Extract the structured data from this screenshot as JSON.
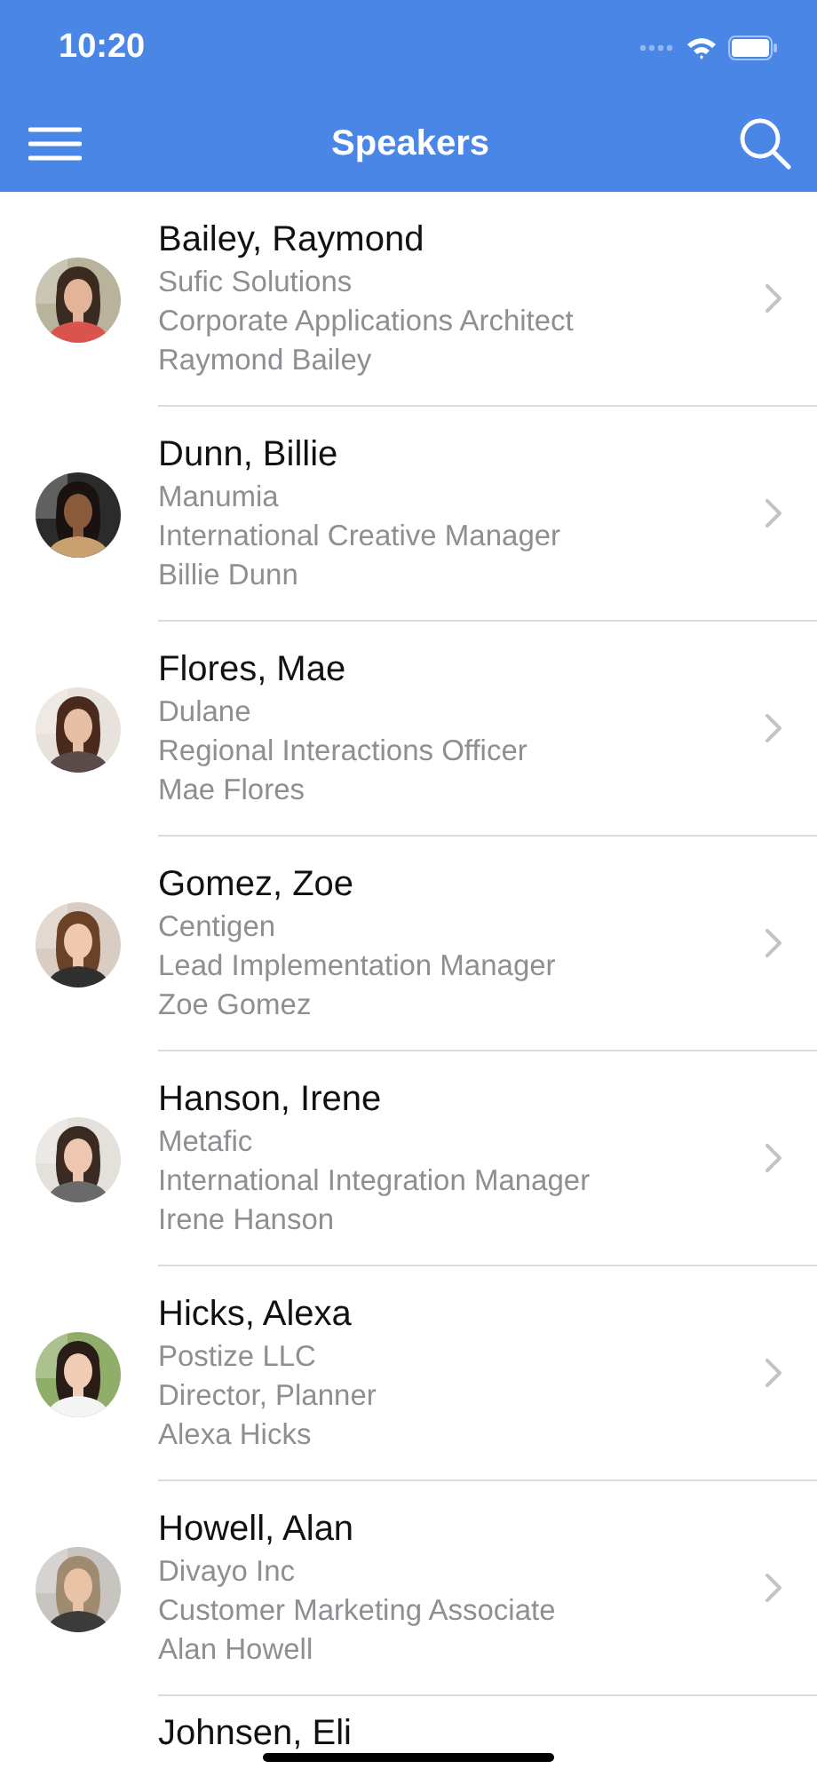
{
  "status_bar": {
    "time": "10:20"
  },
  "nav_bar": {
    "title": "Speakers"
  },
  "speakers": [
    {
      "name": "Bailey, Raymond",
      "company": "Sufic Solutions",
      "title": "Corporate Applications Architect",
      "full_name": "Raymond Bailey"
    },
    {
      "name": "Dunn, Billie",
      "company": "Manumia",
      "title": "International Creative Manager",
      "full_name": "Billie Dunn"
    },
    {
      "name": "Flores, Mae",
      "company": "Dulane",
      "title": "Regional Interactions Officer",
      "full_name": "Mae Flores"
    },
    {
      "name": "Gomez, Zoe",
      "company": "Centigen",
      "title": "Lead Implementation Manager",
      "full_name": "Zoe Gomez"
    },
    {
      "name": "Hanson, Irene",
      "company": "Metafic",
      "title": "International Integration Manager",
      "full_name": "Irene Hanson"
    },
    {
      "name": "Hicks, Alexa",
      "company": "Postize LLC",
      "title": "Director, Planner",
      "full_name": "Alexa Hicks"
    },
    {
      "name": "Howell, Alan",
      "company": "Divayo Inc",
      "title": "Customer Marketing Associate",
      "full_name": "Alan Howell"
    },
    {
      "name": "Johnsen, Eli"
    }
  ]
}
